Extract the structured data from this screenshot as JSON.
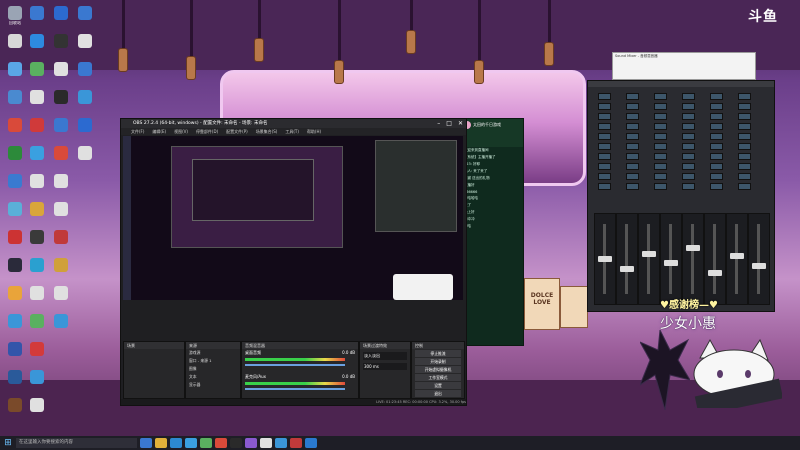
{
  "logo": "斗鱼",
  "desktop_icons_col1": [
    {
      "label": "回收站",
      "color": "#9aa4b4"
    },
    {
      "label": "",
      "color": "#d7d7d7"
    },
    {
      "label": "",
      "color": "#5aa6e6"
    },
    {
      "label": "",
      "color": "#4a8ad0"
    },
    {
      "label": "",
      "color": "#d94a3a"
    },
    {
      "label": "",
      "color": "#2c8a3a"
    },
    {
      "label": "",
      "color": "#3a7ad0"
    },
    {
      "label": "",
      "color": "#5ab0d8"
    },
    {
      "label": "",
      "color": "#cc3333"
    },
    {
      "label": "",
      "color": "#2a2a3a"
    },
    {
      "label": "",
      "color": "#e9a43a"
    },
    {
      "label": "",
      "color": "#3a96d8"
    },
    {
      "label": "",
      "color": "#3355aa"
    },
    {
      "label": "",
      "color": "#2a5a9a"
    },
    {
      "label": "",
      "color": "#7a4a2a"
    }
  ],
  "desktop_icons_col2": [
    {
      "label": "",
      "color": "#3a78d0"
    },
    {
      "label": "",
      "color": "#2d8ae0"
    },
    {
      "label": "",
      "color": "#5ab060"
    },
    {
      "label": "",
      "color": "#e0e0e0"
    },
    {
      "label": "",
      "color": "#d03a3a"
    },
    {
      "label": "",
      "color": "#3aa0e0"
    },
    {
      "label": "",
      "color": "#e0e0e0"
    },
    {
      "label": "",
      "color": "#d9a63a"
    },
    {
      "label": "",
      "color": "#3a3a3a"
    },
    {
      "label": "",
      "color": "#2aa0d0"
    },
    {
      "label": "",
      "color": "#e0e0e0"
    },
    {
      "label": "",
      "color": "#5ab060"
    },
    {
      "label": "",
      "color": "#d33a3a"
    },
    {
      "label": "",
      "color": "#3a96d8"
    },
    {
      "label": "",
      "color": "#e0e0e0"
    }
  ],
  "desktop_icons_col3": [
    {
      "label": "",
      "color": "#2c6ad0"
    },
    {
      "label": "",
      "color": "#333"
    },
    {
      "label": "",
      "color": "#e0e0e0"
    },
    {
      "label": "",
      "color": "#2a2a2a"
    },
    {
      "label": "",
      "color": "#3a78d0"
    },
    {
      "label": "",
      "color": "#d94a3a"
    },
    {
      "label": "",
      "color": "#e0e0e0"
    },
    {
      "label": "",
      "color": "#e0e0e0"
    },
    {
      "label": "",
      "color": "#c03a3a"
    },
    {
      "label": "",
      "color": "#d0a03a"
    },
    {
      "label": "",
      "color": "#e0e0e0"
    },
    {
      "label": "",
      "color": "#3a96d8"
    }
  ],
  "desktop_icons_col4": [
    {
      "label": "",
      "color": "#3a78d0"
    },
    {
      "label": "",
      "color": "#e0e0e0"
    },
    {
      "label": "",
      "color": "#3a78d0"
    },
    {
      "label": "",
      "color": "#3a96d8"
    },
    {
      "label": "",
      "color": "#2c6ad0"
    },
    {
      "label": "",
      "color": "#e0e0e0"
    }
  ],
  "obs": {
    "title": "OBS 27.2.4 (64-bit, windows) - 配置文件: 未命名 - 场景: 未命名",
    "menu": [
      "文件(F)",
      "编辑(E)",
      "视图(V)",
      "停靠部件(D)",
      "配置文件(P)",
      "场景集合(S)",
      "工具(T)",
      "帮助(H)"
    ],
    "scenes_header": "场景",
    "sources_header": "来源",
    "mixer_header": "音频混音器",
    "transitions_header": "场景过渡特效",
    "controls_header": "控制",
    "sources": [
      "游戏源",
      "窗口 - 来源 1",
      "图像",
      "文本",
      "显示器"
    ],
    "audio_tracks": [
      {
        "name": "桌面音频",
        "db": "0.0 dB"
      },
      {
        "name": "麦克风/Aux",
        "db": "0.0 dB"
      }
    ],
    "transition": {
      "type": "淡入淡出",
      "duration": "300 ms"
    },
    "controls": [
      "停止推流",
      "开始录制",
      "开始虚拟摄像机",
      "工作室模式",
      "设置",
      "退出"
    ],
    "status": "LIVE: 01:23:45  REC: 00:00:00  CPU: 3.2%, 30.00 fps"
  },
  "chat": {
    "room": "太田的千日游戏",
    "lines": [
      "欢迎来到直播间",
      "【系统】主播开播了",
      "123: 好耶",
      "路人: 来了来了",
      "感谢 送出的礼物",
      "主播好",
      "666666",
      "哈哈哈哈",
      "来了",
      "晚上好",
      "冲冲冲",
      "哈哈"
    ]
  },
  "mixer_popup": "Sound Mixer - 音频混音器",
  "channels": [
    {
      "level": 0.55
    },
    {
      "level": 0.4
    },
    {
      "level": 0.62
    },
    {
      "level": 0.48
    },
    {
      "level": 0.7
    },
    {
      "level": 0.35
    },
    {
      "level": 0.58
    },
    {
      "level": 0.44
    }
  ],
  "bag_text": "DOLCE\nLOVE",
  "banner": {
    "top": "♥感谢榜—♥",
    "name": "少女小惠"
  },
  "taskbar": {
    "search_placeholder": "在这里输入你要搜索的内容",
    "icon_colors": [
      "#3a78d0",
      "#e0b03a",
      "#2c8ad0",
      "#3aa0e0",
      "#5ab060",
      "#d94a3a",
      "#2a2a2a",
      "#8a5ad0",
      "#e0e0e0",
      "#3a96d8",
      "#c03a3a",
      "#2a7ad0"
    ]
  }
}
